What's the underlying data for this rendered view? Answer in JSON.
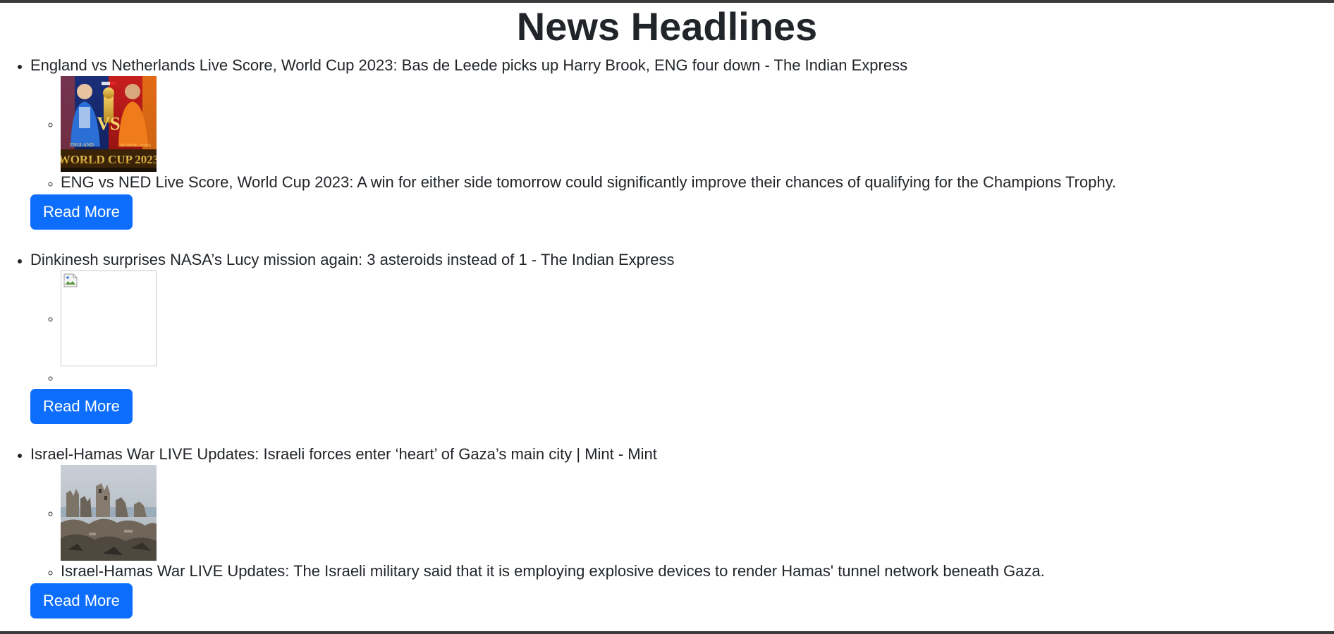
{
  "header": {
    "title": "News Headlines"
  },
  "colors": {
    "button_primary": "#0d6efd",
    "text": "#212529"
  },
  "articles": [
    {
      "headline": "England vs Netherlands Live Score, World Cup 2023: Bas de Leede picks up Harry Brook, ENG four down - The Indian Express",
      "image": "cricket-poster",
      "image_text": {
        "left_team": "ENGLAND",
        "right_team": "NETHERLANDS",
        "vs": "VS",
        "banner": "WORLD CUP 2023"
      },
      "description": "ENG vs NED Live Score, World Cup 2023: A win for either side tomorrow could significantly improve their chances of qualifying for the Champions Trophy.",
      "button_label": "Read More"
    },
    {
      "headline": "Dinkinesh surprises NASA’s Lucy mission again: 3 asteroids instead of 1 - The Indian Express",
      "image": "broken-image",
      "description": "",
      "button_label": "Read More"
    },
    {
      "headline": "Israel-Hamas War LIVE Updates: Israeli forces enter ‘heart’ of Gaza’s main city | Mint - Mint",
      "image": "ruined-city-photo",
      "description": "Israel-Hamas War LIVE Updates: The Israeli military said that it is employing explosive devices to render Hamas' tunnel network beneath Gaza.",
      "button_label": "Read More"
    }
  ]
}
